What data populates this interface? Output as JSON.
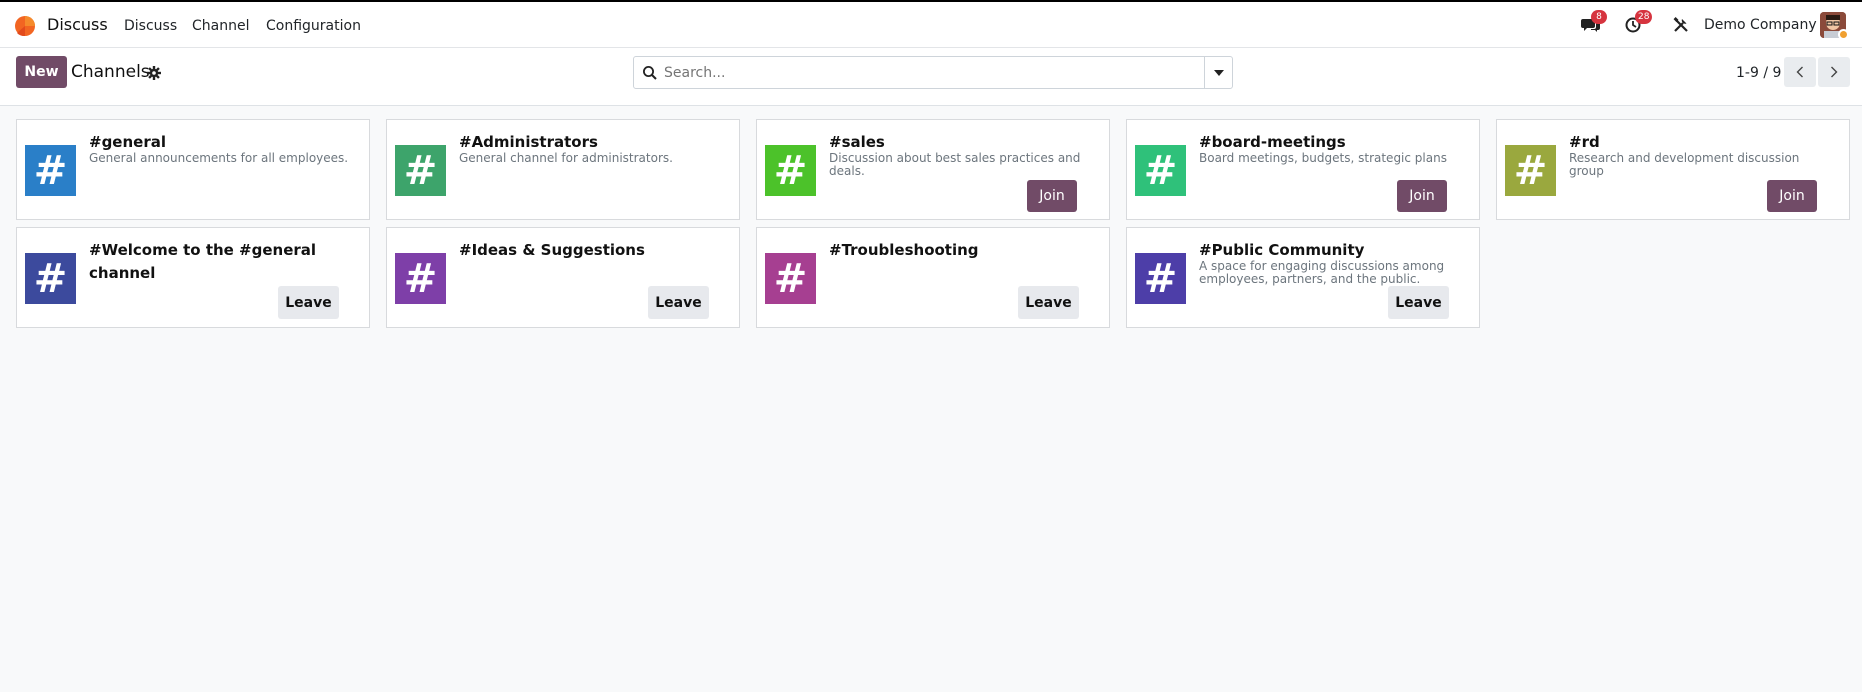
{
  "app": {
    "name": "Discuss"
  },
  "menu": {
    "items": [
      "Discuss",
      "Channel",
      "Configuration"
    ]
  },
  "systray": {
    "messages_count": "8",
    "activities_count": "28",
    "company": "Demo Company"
  },
  "control_panel": {
    "new_label": "New",
    "title": "Channels",
    "search_placeholder": "Search...",
    "pager": "1-9 / 9"
  },
  "colors": {
    "brand": "#714b67",
    "badge": "#d6343f"
  },
  "channels": [
    {
      "name": "#general",
      "description": "General announcements for all employees.",
      "action": "",
      "color": "#2a7fc8"
    },
    {
      "name": "#Administrators",
      "description": "General channel for administrators.",
      "action": "",
      "color": "#3da46b"
    },
    {
      "name": "#sales",
      "description": "Discussion about best sales practices and deals.",
      "action": "Join",
      "color": "#4cc22a"
    },
    {
      "name": "#board-meetings",
      "description": "Board meetings, budgets, strategic plans",
      "action": "Join",
      "color": "#2fc17a"
    },
    {
      "name": "#rd",
      "description": "Research and development discussion group",
      "action": "Join",
      "color": "#9aa83e"
    },
    {
      "name": "#Welcome to the #general channel",
      "description": "",
      "action": "Leave",
      "color": "#3c4a9d"
    },
    {
      "name": "#Ideas & Suggestions",
      "description": "",
      "action": "Leave",
      "color": "#7e3fa8"
    },
    {
      "name": "#Troubleshooting",
      "description": "",
      "action": "Leave",
      "color": "#a63f91"
    },
    {
      "name": "#Public Community",
      "description": "A space for engaging discussions among employees, partners, and the public.",
      "action": "Leave",
      "color": "#4d3ea8"
    }
  ]
}
